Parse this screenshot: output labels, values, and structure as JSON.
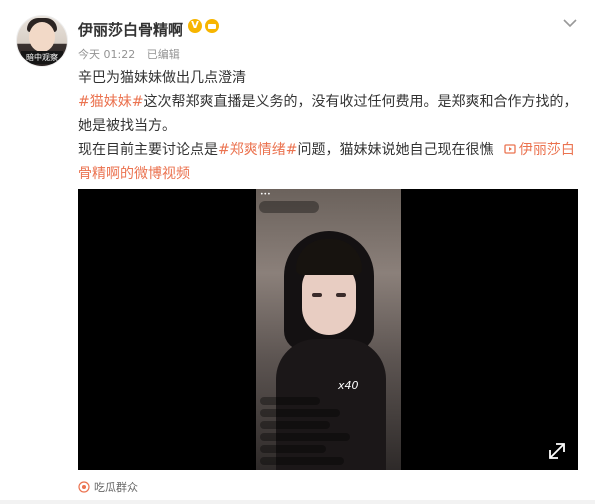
{
  "post": {
    "author": "伊丽莎白骨精啊",
    "avatar_tag": "暗中观察",
    "time": "今天 01:22",
    "edited": "已编辑",
    "line1": "辛巴为猫妹妹做出几点澄清",
    "tag1": "#猫妹妹#",
    "line2a": "这次帮郑爽直播是义务的，没有收过任何费用。是郑爽和合作方找的，",
    "line2b": "她是被找当方。",
    "line3a": "现在目前主要讨论点是",
    "tag2": "#郑爽情绪#",
    "line3b": "问题，猫妹妹说她自己现在很憔",
    "video_link_a": "伊丽莎白",
    "video_link_b": "骨精啊的微博视频",
    "video_overlay_x40": "x40",
    "footer_source": "吃瓜群众"
  },
  "colors": {
    "accent": "#eb7350",
    "verified": "#f7b500"
  }
}
